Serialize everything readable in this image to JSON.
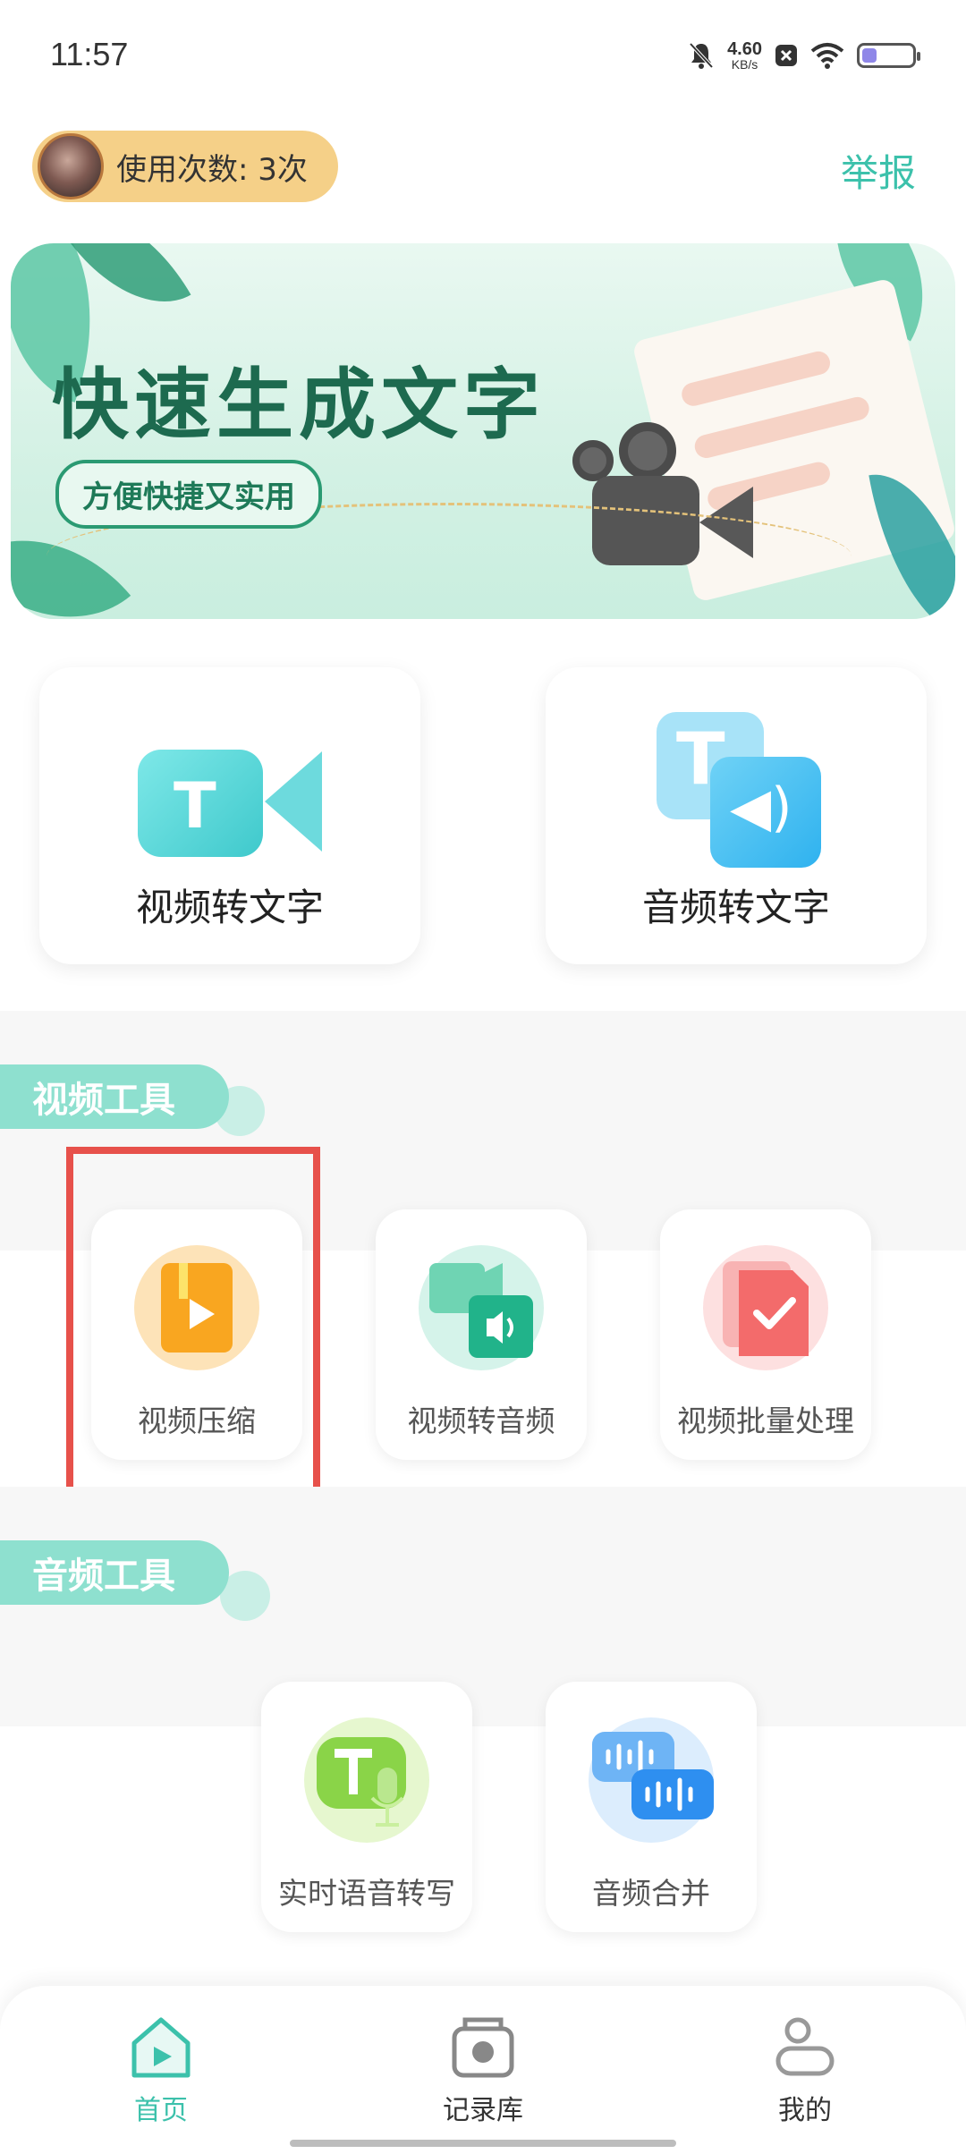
{
  "status_bar": {
    "time": "11:57",
    "net_speed_value": "4.60",
    "net_speed_unit": "KB/s",
    "icons": [
      "mute-bell-icon",
      "close-box-icon",
      "wifi-icon",
      "battery-icon"
    ]
  },
  "header": {
    "usage_label": "使用次数: 3次",
    "report_label": "举报"
  },
  "banner": {
    "title": "快速生成文字",
    "subtitle": "方便快捷又实用"
  },
  "features": [
    {
      "label": "视频转文字",
      "icon": "video-text-icon"
    },
    {
      "label": "音频转文字",
      "icon": "audio-text-icon"
    }
  ],
  "sections": {
    "video_tools": {
      "title": "视频工具",
      "items": [
        {
          "label": "视频压缩",
          "icon": "zip-video-icon"
        },
        {
          "label": "视频转音频",
          "icon": "video-to-audio-icon"
        },
        {
          "label": "视频批量处理",
          "icon": "batch-check-icon"
        }
      ]
    },
    "audio_tools": {
      "title": "音频工具",
      "items": [
        {
          "label": "实时语音转写",
          "icon": "voice-transcribe-icon"
        },
        {
          "label": "音频合并",
          "icon": "audio-merge-icon"
        }
      ]
    }
  },
  "bottom_nav": [
    {
      "label": "首页",
      "icon": "home-icon",
      "active": true
    },
    {
      "label": "记录库",
      "icon": "record-box-icon",
      "active": false
    },
    {
      "label": "我的",
      "icon": "user-icon",
      "active": false
    }
  ],
  "colors": {
    "accent": "#3cc1ab",
    "pill": "#f5d088",
    "section_tab": "#8ee0cf",
    "highlight": "#e7514b"
  }
}
